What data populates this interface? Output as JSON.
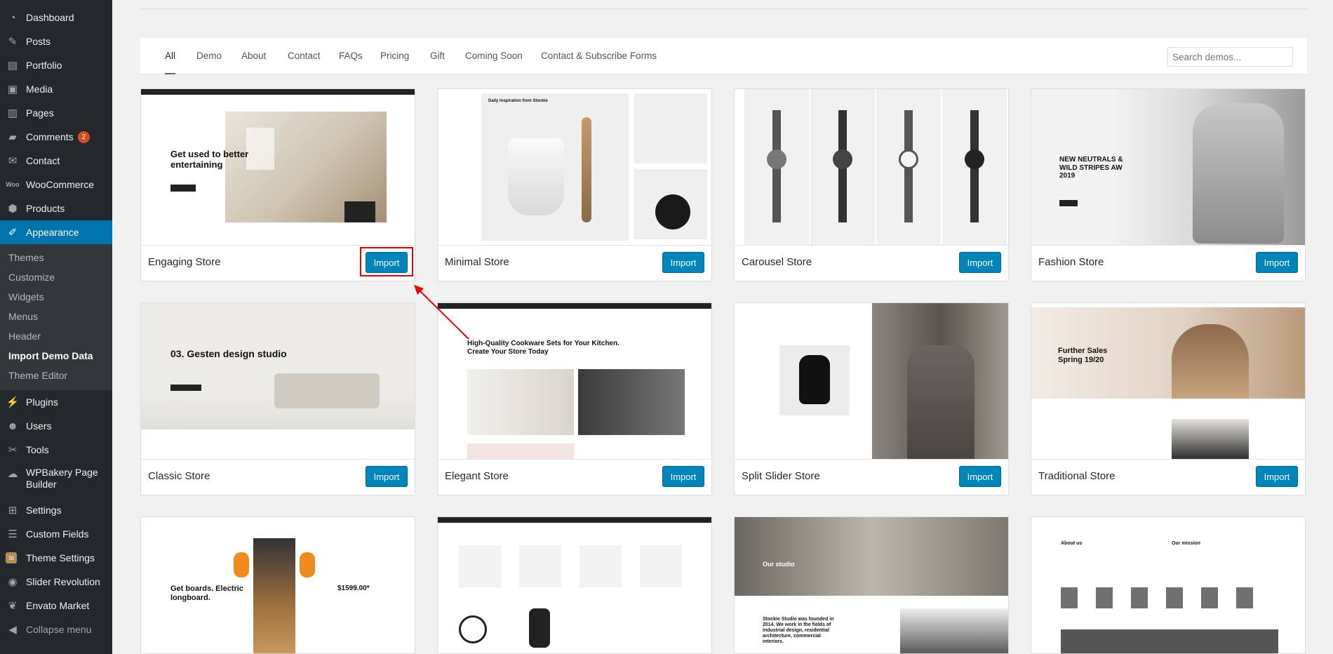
{
  "sidebar": {
    "items": [
      {
        "label": "Dashboard",
        "icon": "dashboard-icon"
      },
      {
        "label": "Posts",
        "icon": "pin-icon"
      },
      {
        "label": "Portfolio",
        "icon": "portfolio-icon"
      },
      {
        "label": "Media",
        "icon": "media-icon"
      },
      {
        "label": "Pages",
        "icon": "pages-icon"
      },
      {
        "label": "Comments",
        "icon": "comments-icon",
        "badge": "2"
      },
      {
        "label": "Contact",
        "icon": "mail-icon"
      },
      {
        "label": "WooCommerce",
        "icon": "woocommerce-icon"
      },
      {
        "label": "Products",
        "icon": "products-icon"
      },
      {
        "label": "Appearance",
        "icon": "appearance-icon"
      }
    ],
    "appearance_sub": [
      "Themes",
      "Customize",
      "Widgets",
      "Menus",
      "Header",
      "Import Demo Data",
      "Theme Editor"
    ],
    "items_after": [
      {
        "label": "Plugins",
        "icon": "plugins-icon"
      },
      {
        "label": "Users",
        "icon": "users-icon"
      },
      {
        "label": "Tools",
        "icon": "tools-icon"
      },
      {
        "label": "WPBakery Page Builder",
        "icon": "wpbakery-icon"
      },
      {
        "label": "Settings",
        "icon": "settings-icon"
      },
      {
        "label": "Custom Fields",
        "icon": "custom-fields-icon"
      },
      {
        "label": "Theme Settings",
        "icon": "theme-settings-icon"
      },
      {
        "label": "Slider Revolution",
        "icon": "slider-revolution-icon"
      },
      {
        "label": "Envato Market",
        "icon": "envato-icon"
      }
    ],
    "collapse": "Collapse menu"
  },
  "filter_tabs": [
    "All",
    "Demo",
    "About",
    "Contact",
    "FAQs",
    "Pricing",
    "Gift",
    "Coming Soon",
    "Contact & Subscribe Forms"
  ],
  "search": {
    "placeholder": "Search demos..."
  },
  "import_label": "Import",
  "demos": [
    {
      "name": "Engaging Store"
    },
    {
      "name": "Minimal Store"
    },
    {
      "name": "Carousel Store"
    },
    {
      "name": "Fashion Store"
    },
    {
      "name": "Classic Store"
    },
    {
      "name": "Elegant Store"
    },
    {
      "name": "Split Slider Store"
    },
    {
      "name": "Traditional Store"
    }
  ],
  "thumb_text": {
    "engaging": "Get used to better entertaining",
    "minimal": "Daily inspiration from Stockie",
    "fashion": "NEW NEUTRALS & WILD STRIPES AW 2019",
    "classic": "03. Gesten design studio",
    "elegant": "High-Quality Cookware Sets for Your Kitchen. Create Your Store Today",
    "traditional": "Further Sales Spring 19/20",
    "board": "Get boards. Electric longboard.",
    "board_price": "$1599.00*",
    "studio": "Our studio",
    "studio_body": "Stockie Studio was founded in 2014. We work in the fields of industrial design, residential architecture, commercial interiors.",
    "about": "About us",
    "mission": "Our mission"
  },
  "colors": {
    "sidebar": "#23282d",
    "accent": "#0073aa",
    "button": "#0085ba",
    "highlight": "#e00000"
  }
}
